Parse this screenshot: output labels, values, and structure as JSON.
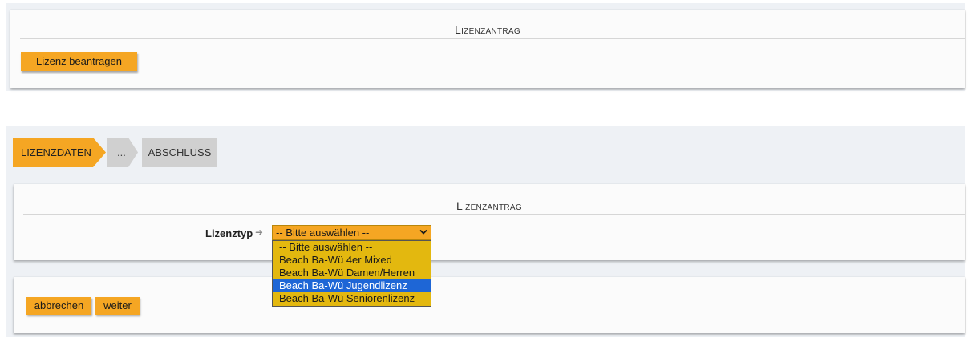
{
  "top_panel": {
    "title": "Lizenzantrag",
    "apply_button": "Lizenz beantragen"
  },
  "steps": [
    {
      "label": "Lizenzdaten",
      "state": "active"
    },
    {
      "label": "...",
      "state": "inactive"
    },
    {
      "label": "Abschluss",
      "state": "inactive"
    }
  ],
  "form_panel": {
    "title": "Lizenzantrag",
    "field_label": "Lizenztyp",
    "select": {
      "value": "-- Bitte auswählen --",
      "options": [
        "-- Bitte auswählen --",
        "Beach Ba-Wü 4er Mixed",
        "Beach Ba-Wü Damen/Herren",
        "Beach Ba-Wü Jugendlizenz",
        "Beach Ba-Wü Seniorenlizenz"
      ],
      "highlighted_index": 3
    }
  },
  "actions": {
    "cancel": "abbrechen",
    "next": "weiter"
  },
  "colors": {
    "accent": "#f5a623",
    "dropdown_bg": "#e3b80f",
    "highlight": "#1e66d6",
    "step_inactive": "#d0d0d0",
    "band_bg": "#eef1f5"
  }
}
